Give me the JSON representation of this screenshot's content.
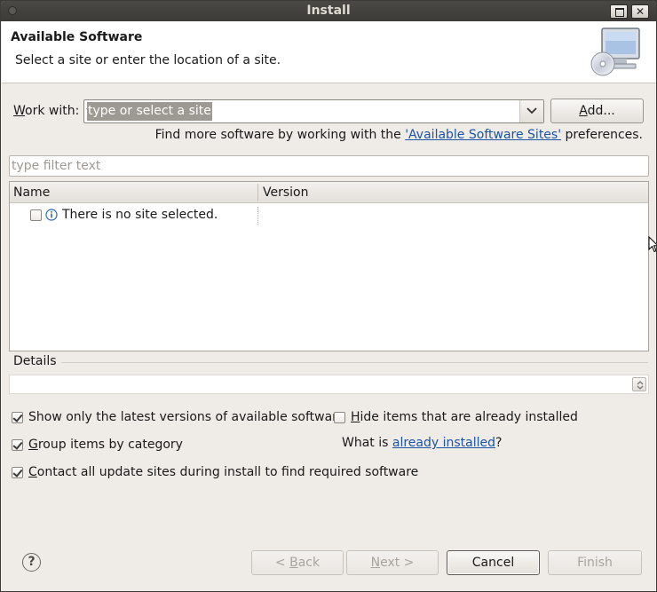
{
  "window": {
    "title": "Install"
  },
  "header": {
    "title": "Available Software",
    "description": "Select a site or enter the location of a site."
  },
  "work_with": {
    "label_prefix": "W",
    "label_rest": "ork with:",
    "placeholder": "type or select a site",
    "add_label_prefix": "A",
    "add_label_rest": "dd..."
  },
  "more_software": {
    "before": "Find more software by working with the ",
    "link": "'Available Software Sites'",
    "after": " preferences."
  },
  "filter": {
    "placeholder": "type filter text"
  },
  "table": {
    "columns": [
      "Name",
      "Version"
    ],
    "rows": [
      {
        "name": "There is no site selected.",
        "version": "",
        "checked": false,
        "icon": "info-icon"
      }
    ]
  },
  "details": {
    "label": "Details"
  },
  "options": {
    "show_latest": {
      "label": "Show only the latest versions of available software",
      "checked": true
    },
    "hide_installed": {
      "prefix": "H",
      "rest": "ide items that are already installed",
      "checked": false
    },
    "group_by_category": {
      "prefix": "G",
      "rest": "roup items by category",
      "checked": true
    },
    "contact_sites": {
      "prefix": "C",
      "rest": "ontact all update sites during install to find required software",
      "checked": true
    },
    "what_is": {
      "before": "What is ",
      "link": "already installed",
      "after": "?"
    }
  },
  "buttons": {
    "back": {
      "prefix": "< ",
      "mnemonic": "B",
      "rest": "ack",
      "enabled": false
    },
    "next": {
      "mnemonic": "N",
      "rest": "ext >",
      "enabled": false
    },
    "cancel": {
      "label": "Cancel",
      "enabled": true
    },
    "finish": {
      "label": "Finish",
      "enabled": false
    }
  },
  "colors": {
    "titlebar": "#3c3b37",
    "dialog_bg": "#efebe7",
    "link": "#1c55a6",
    "selection": "#9c9a92"
  }
}
